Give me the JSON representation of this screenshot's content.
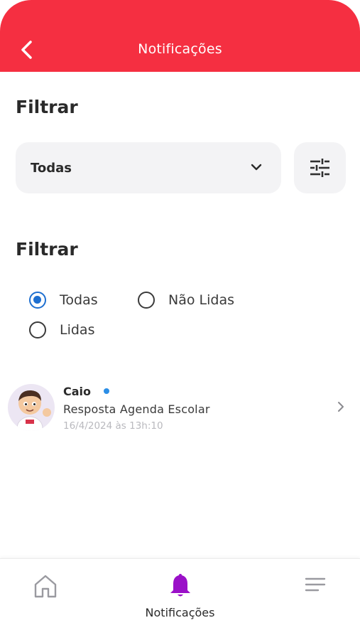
{
  "header": {
    "title": "Notificações"
  },
  "filter_dropdown": {
    "title": "Filtrar",
    "selected": "Todas"
  },
  "filter_radio": {
    "title": "Filtrar",
    "options": [
      {
        "label": "Todas",
        "checked": true
      },
      {
        "label": "Não Lidas",
        "checked": false
      },
      {
        "label": "Lidas",
        "checked": false
      }
    ]
  },
  "notifications": [
    {
      "sender": "Caio",
      "message": "Resposta Agenda Escolar",
      "date": "16/4/2024 às 13h:10",
      "unread": true
    }
  ],
  "tabbar": {
    "active_label": "Notificações"
  },
  "colors": {
    "header": "#f52f41",
    "active_tab": "#9a10c8",
    "radio_selected": "#1e6fd0",
    "unread_dot": "#2b8ee6"
  }
}
